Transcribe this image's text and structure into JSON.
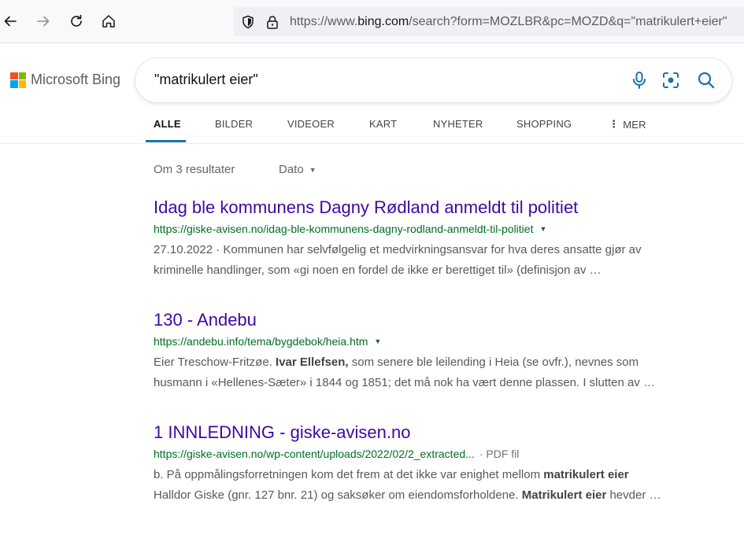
{
  "browser": {
    "url_prefix": "https://www.",
    "url_host": "bing.com",
    "url_rest": "/search?form=MOZLBR&pc=MOZD&q=\"matrikulert+eier\""
  },
  "logo": {
    "text": "Microsoft Bing",
    "colors": [
      "#f25022",
      "#7fba00",
      "#00a4ef",
      "#ffb900"
    ]
  },
  "search": {
    "query": "\"matrikulert eier\""
  },
  "tabs": [
    {
      "label": "ALLE",
      "active": true
    },
    {
      "label": "BILDER"
    },
    {
      "label": "VIDEOER"
    },
    {
      "label": "KART"
    },
    {
      "label": "NYHETER"
    },
    {
      "label": "SHOPPING"
    },
    {
      "label": "MER"
    }
  ],
  "results_meta": {
    "count_text": "Om 3 resultater",
    "date_filter": "Dato"
  },
  "results": [
    {
      "title": "Idag ble kommunens Dagny Rødland anmeldt til politiet",
      "url": "https://giske-avisen.no/idag-ble-kommunens-dagny-rodland-anmeldt-til-politiet",
      "line1_pre": "27.10.2022 · Kommunen har selvfølgelig et medvirkningsansvar for hva deres ansatte gjør av",
      "line2_pre": "kriminelle handlinger, som «gi noen en fordel de ikke er berettiget til» (definisjon av …"
    },
    {
      "title": "130 - Andebu",
      "url": "https://andebu.info/tema/bygdebok/heia.htm",
      "line1_pre": "Eier Treschow-Fritzøe. ",
      "line1_bold": "Ivar Ellefsen,",
      "line1_post": " som senere ble leilending i Heia (se ovfr.), nevnes som",
      "line2_pre": "husmann i «Hellenes-Sæter» i 1844 og 1851; det må nok ha vært denne plassen. I slutten av …"
    },
    {
      "title": "1 INNLEDNING - giske-avisen.no",
      "url": "https://giske-avisen.no/wp-content/uploads/2022/02/2_extracted...",
      "file_type": "· PDF fil",
      "line1_pre": "b. På oppmålingsforretningen kom det frem at det ikke var enighet mellom ",
      "line1_bold": "matrikulert eier",
      "line2_pre": "Halldor Giske (gnr. 127 bnr. 21) og saksøker om eiendomsforholdene. ",
      "line2_bold": "Matrikulert eier",
      "line2_post": " hevder …"
    }
  ]
}
